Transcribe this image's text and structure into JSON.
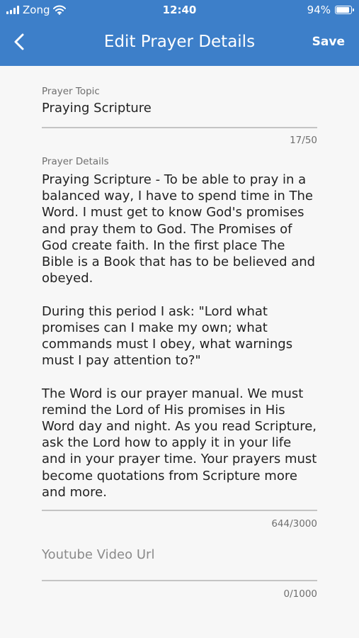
{
  "status_bar": {
    "carrier": "Zong",
    "time": "12:40",
    "battery_text": "94%",
    "battery_level": 0.94
  },
  "header": {
    "title": "Edit Prayer Details",
    "save_label": "Save",
    "back_icon": "chevron-left-icon",
    "background_color": "#3d7fc9"
  },
  "form": {
    "topic": {
      "label": "Prayer Topic",
      "value": "Praying Scripture",
      "counter": "17/50"
    },
    "details": {
      "label": "Prayer Details",
      "value": "Praying Scripture - To be able to pray in a balanced way, I have to spend time in The Word. I must get to know God's promises and pray them to God. The Promises of God create faith. In the first place The Bible is a Book that has to be believed and obeyed.\n\nDuring this period I ask: \"Lord what promises can I make my own; what commands must I obey, what warnings must I pay attention to?\"\n\nThe Word is our prayer manual. We must remind the Lord of His promises in His Word day and night. As you read Scripture, ask the Lord how to apply it in your life and in your prayer time. Your prayers must become quotations from Scripture more and more.",
      "counter": "644/3000"
    },
    "youtube": {
      "placeholder": "Youtube Video Url",
      "counter": "0/1000"
    }
  }
}
